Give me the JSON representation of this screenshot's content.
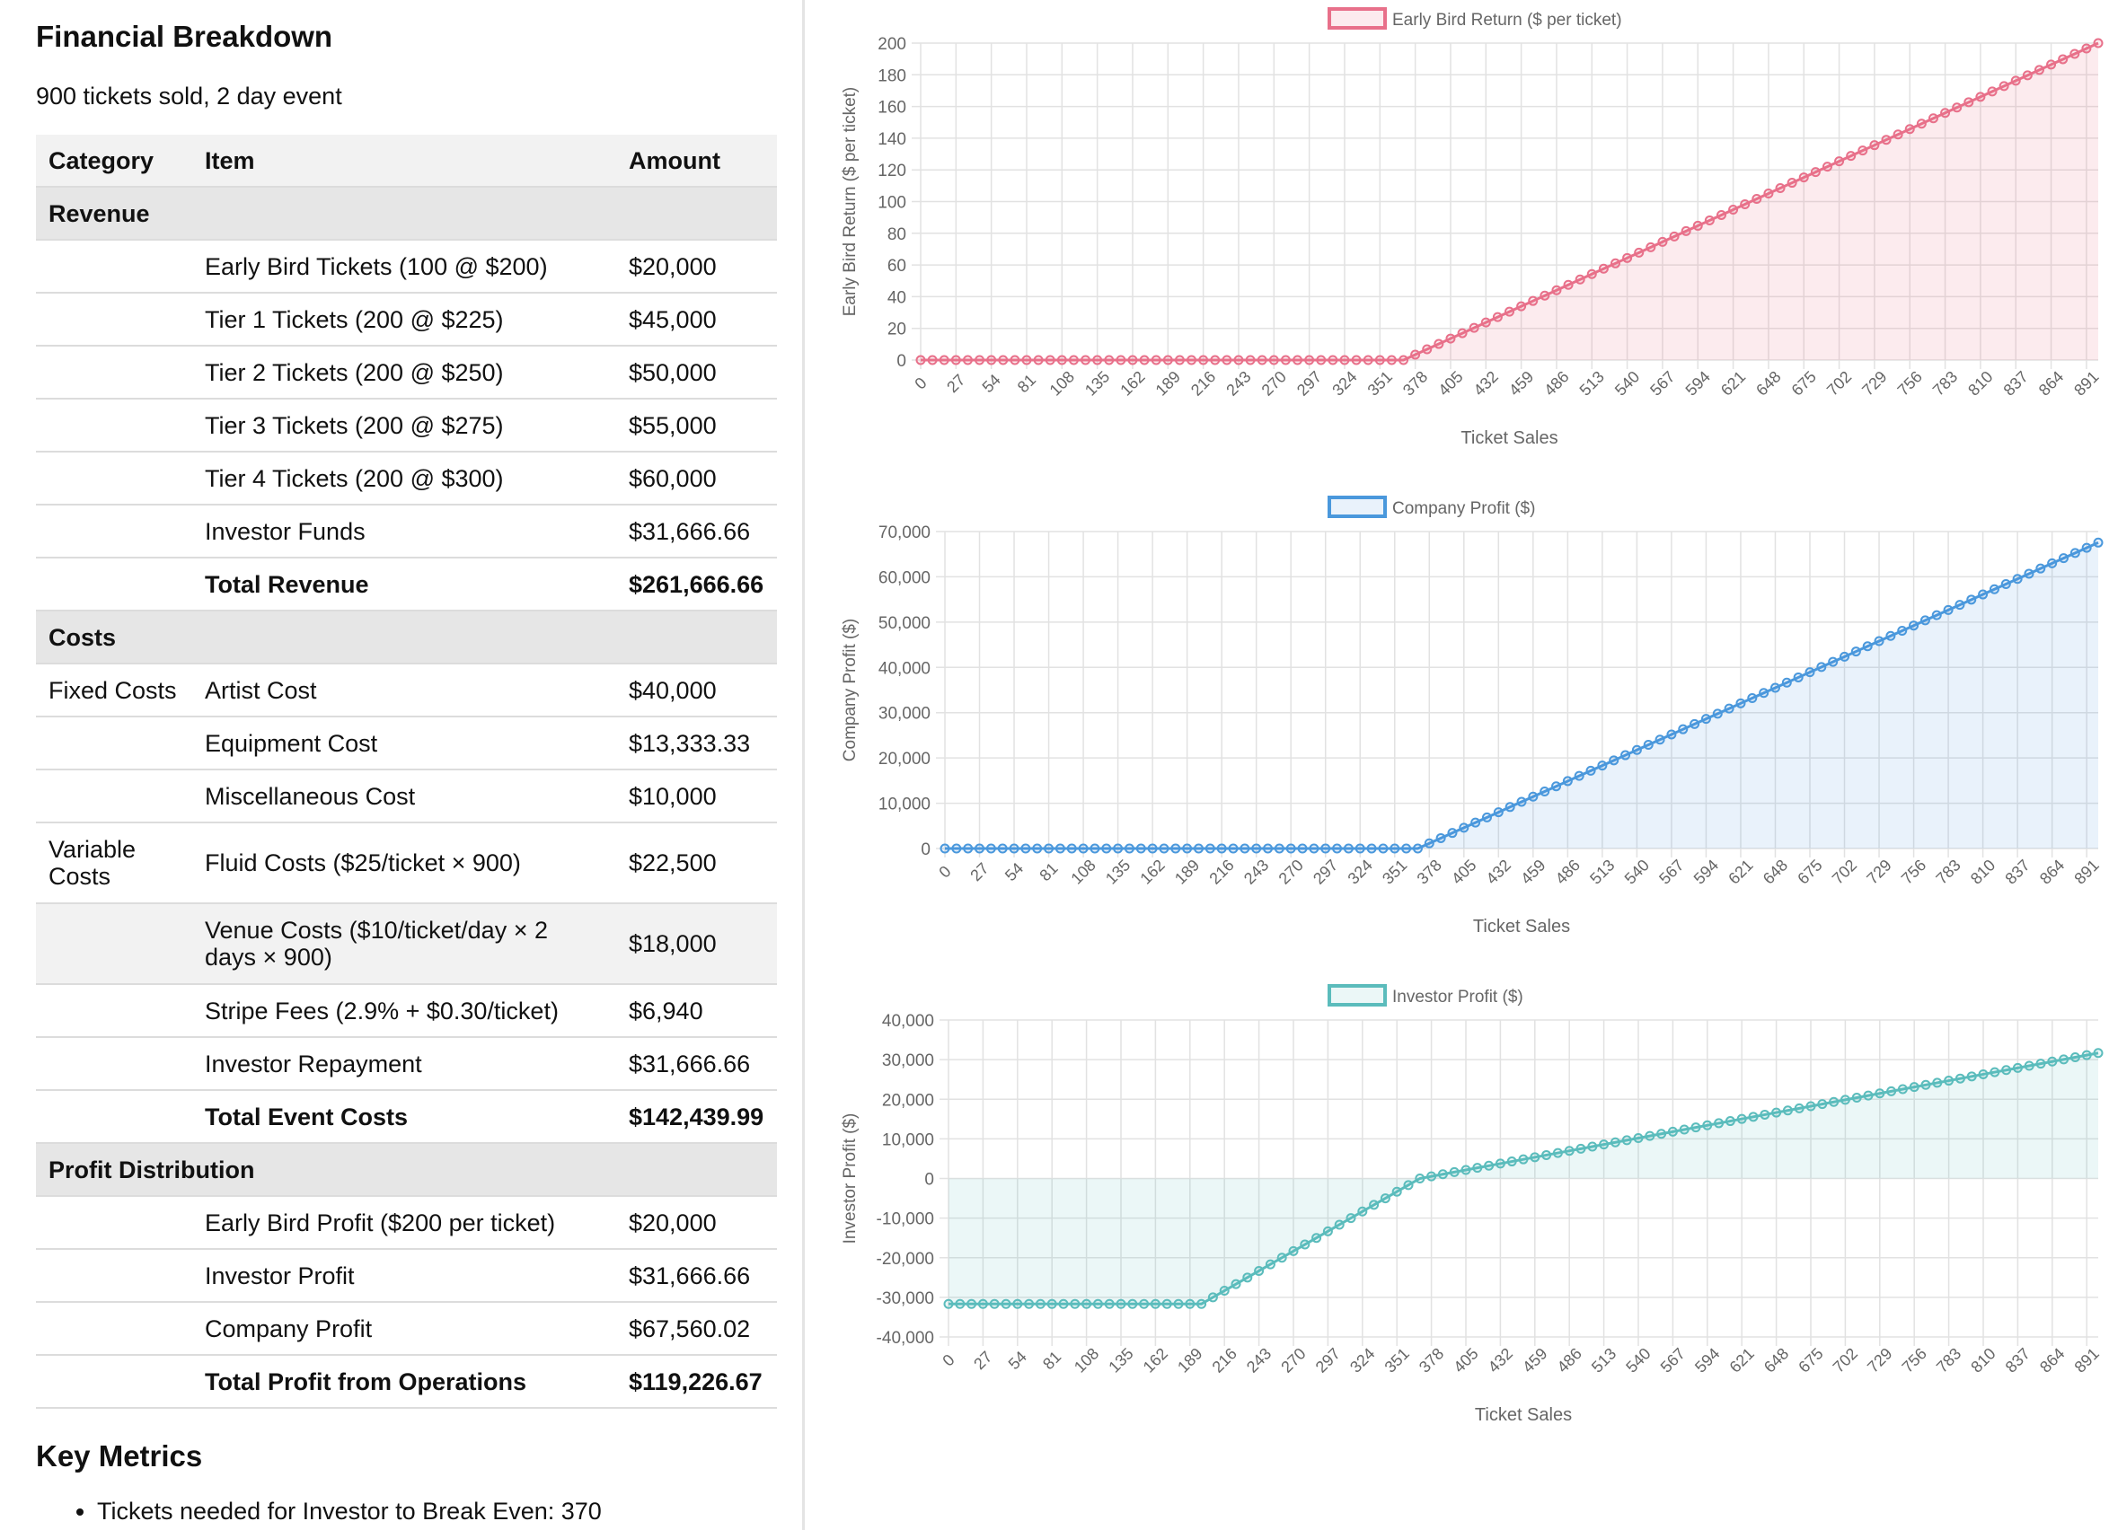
{
  "breakdown": {
    "title": "Financial Breakdown",
    "subtitle": "900 tickets sold, 2 day event",
    "headers": {
      "category": "Category",
      "item": "Item",
      "amount": "Amount"
    },
    "rows": [
      {
        "section": "Revenue"
      },
      {
        "category": "",
        "item": "Early Bird Tickets (100 @ $200)",
        "amount": "$20,000"
      },
      {
        "category": "",
        "item": "Tier 1 Tickets (200 @ $225)",
        "amount": "$45,000"
      },
      {
        "category": "",
        "item": "Tier 2 Tickets (200 @ $250)",
        "amount": "$50,000"
      },
      {
        "category": "",
        "item": "Tier 3 Tickets (200 @ $275)",
        "amount": "$55,000"
      },
      {
        "category": "",
        "item": "Tier 4 Tickets (200 @ $300)",
        "amount": "$60,000"
      },
      {
        "category": "",
        "item": "Investor Funds",
        "amount": "$31,666.66"
      },
      {
        "category": "",
        "item": "Total Revenue",
        "amount": "$261,666.66",
        "total": true
      },
      {
        "section": "Costs"
      },
      {
        "category": "Fixed Costs",
        "item": "Artist Cost",
        "amount": "$40,000"
      },
      {
        "category": "",
        "item": "Equipment Cost",
        "amount": "$13,333.33"
      },
      {
        "category": "",
        "item": "Miscellaneous Cost",
        "amount": "$10,000"
      },
      {
        "category": "Variable Costs",
        "item": "Fluid Costs ($25/ticket × 900)",
        "amount": "$22,500",
        "tall": true
      },
      {
        "category": "",
        "item": "Venue Costs ($10/ticket/day × 2 days × 900)",
        "amount": "$18,000",
        "tall": true,
        "shaded": true
      },
      {
        "category": "",
        "item": "Stripe Fees (2.9% + $0.30/ticket)",
        "amount": "$6,940"
      },
      {
        "category": "",
        "item": "Investor Repayment",
        "amount": "$31,666.66"
      },
      {
        "category": "",
        "item": "Total Event Costs",
        "amount": "$142,439.99",
        "total": true
      },
      {
        "section": "Profit Distribution"
      },
      {
        "category": "",
        "item": "Early Bird Profit ($200 per ticket)",
        "amount": "$20,000"
      },
      {
        "category": "",
        "item": "Investor Profit",
        "amount": "$31,666.66"
      },
      {
        "category": "",
        "item": "Company Profit",
        "amount": "$67,560.02"
      },
      {
        "category": "",
        "item": "Total Profit from Operations",
        "amount": "$119,226.67",
        "total": true
      }
    ]
  },
  "metrics": {
    "title": "Key Metrics",
    "items": [
      "Tickets needed for Investor to Break Even: 370"
    ]
  },
  "chart_data": [
    {
      "type": "area",
      "series_name": "Early Bird Return ($ per ticket)",
      "color": "#e8708a",
      "fill": "rgba(232,112,138,0.14)",
      "xlabel": "Ticket Sales",
      "ylabel": "Early Bird Return ($ per ticket)",
      "ylim": [
        0,
        200
      ],
      "yticks": [
        0,
        20,
        40,
        60,
        80,
        100,
        120,
        140,
        160,
        180,
        200
      ],
      "x_tick_labels": [
        0,
        27,
        54,
        81,
        108,
        135,
        162,
        189,
        216,
        243,
        270,
        297,
        324,
        351,
        378,
        405,
        432,
        459,
        486,
        513,
        540,
        567,
        594,
        621,
        648,
        675,
        702,
        729,
        756,
        783,
        810,
        837,
        864,
        891
      ],
      "x_range": [
        0,
        900
      ],
      "point_step": 9,
      "breakpoints": [
        [
          0,
          0
        ],
        [
          369,
          0
        ],
        [
          900,
          200
        ]
      ]
    },
    {
      "type": "area",
      "series_name": "Company Profit ($)",
      "color": "#4a98dc",
      "fill": "rgba(74,152,220,0.12)",
      "xlabel": "Ticket Sales",
      "ylabel": "Company Profit ($)",
      "ylim": [
        0,
        70000
      ],
      "yticks": [
        0,
        10000,
        20000,
        30000,
        40000,
        50000,
        60000,
        70000
      ],
      "x_tick_labels": [
        0,
        27,
        54,
        81,
        108,
        135,
        162,
        189,
        216,
        243,
        270,
        297,
        324,
        351,
        378,
        405,
        432,
        459,
        486,
        513,
        540,
        567,
        594,
        621,
        648,
        675,
        702,
        729,
        756,
        783,
        810,
        837,
        864,
        891
      ],
      "x_range": [
        0,
        900
      ],
      "point_step": 9,
      "breakpoints": [
        [
          0,
          0
        ],
        [
          369,
          0
        ],
        [
          900,
          67560
        ]
      ]
    },
    {
      "type": "area",
      "series_name": "Investor Profit ($)",
      "color": "#5bbcbc",
      "fill": "rgba(91,188,188,0.12)",
      "xlabel": "Ticket Sales",
      "ylabel": "Investor Profit ($)",
      "ylim": [
        -40000,
        40000
      ],
      "yticks": [
        -40000,
        -30000,
        -20000,
        -10000,
        0,
        10000,
        20000,
        30000,
        40000
      ],
      "x_tick_labels": [
        0,
        27,
        54,
        81,
        108,
        135,
        162,
        189,
        216,
        243,
        270,
        297,
        324,
        351,
        378,
        405,
        432,
        459,
        486,
        513,
        540,
        567,
        594,
        621,
        648,
        675,
        702,
        729,
        756,
        783,
        810,
        837,
        864,
        891
      ],
      "x_range": [
        0,
        900
      ],
      "point_step": 9,
      "breakpoints": [
        [
          0,
          -31667
        ],
        [
          198,
          -31667
        ],
        [
          369,
          0
        ],
        [
          900,
          31667
        ]
      ]
    }
  ]
}
